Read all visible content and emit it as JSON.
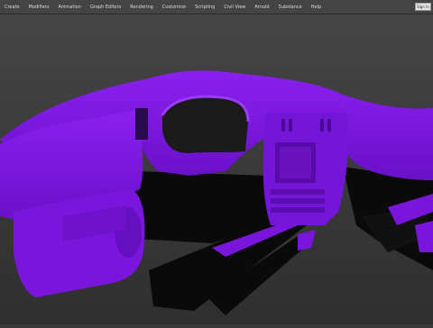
{
  "menubar": {
    "items": [
      "Create",
      "Modifiers",
      "Animation",
      "Graph Editors",
      "Rendering",
      "Customize",
      "Scripting",
      "Civil View",
      "Arnold",
      "Substance",
      "Help"
    ],
    "sign_in_label": "Sign In"
  },
  "viewport": {
    "model": "car-interior-dashboard-and-door-panel",
    "model_color": "#7a16d6"
  }
}
